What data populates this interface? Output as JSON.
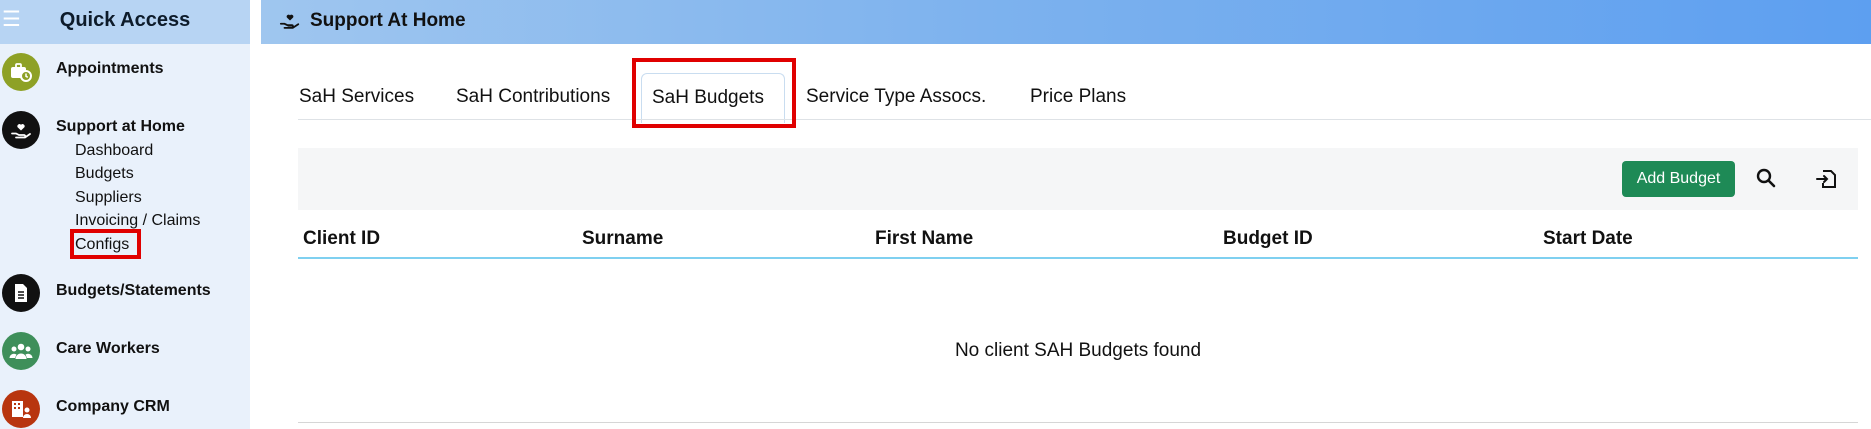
{
  "sidebar": {
    "title": "Quick Access",
    "menu_icon": "hamburger-icon",
    "items": [
      {
        "label": "Appointments",
        "icon": "calendar-briefcase-icon",
        "color": "#8ea126"
      },
      {
        "label": "Support at Home",
        "icon": "heart-hand-icon",
        "color": "#111111",
        "subitems": [
          "Dashboard",
          "Budgets",
          "Suppliers",
          "Invoicing / Claims",
          "Configs"
        ]
      },
      {
        "label": "Budgets/Statements",
        "icon": "document-icon",
        "color": "#111111"
      },
      {
        "label": "Care Workers",
        "icon": "people-group-icon",
        "color": "#3e8f5a"
      },
      {
        "label": "Company CRM",
        "icon": "building-person-icon",
        "color": "#b8350f"
      }
    ]
  },
  "header": {
    "title": "Support At Home",
    "icon": "heart-hand-icon"
  },
  "tabs": [
    "SaH Services",
    "SaH Contributions",
    "SaH Budgets",
    "Service Type Assocs.",
    "Price Plans"
  ],
  "active_tab": "SaH Budgets",
  "toolbar": {
    "add_label": "Add Budget",
    "search_icon": "search-icon",
    "export_icon": "export-icon"
  },
  "table": {
    "columns": [
      "Client ID",
      "Surname",
      "First Name",
      "Budget ID",
      "Start Date"
    ],
    "empty_message": "No client SAH Budgets found"
  },
  "colors": {
    "highlight": "#e00000",
    "primary_button": "#1e8a56",
    "header_rule": "#7fd0f0"
  }
}
